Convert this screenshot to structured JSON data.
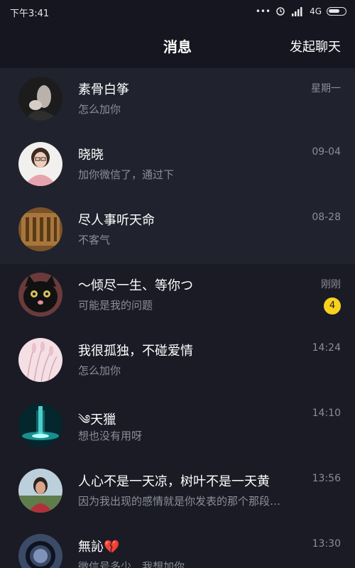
{
  "status_bar": {
    "time": "下午3:41",
    "network": "4G",
    "icons": [
      "more-dots-icon",
      "alarm-icon",
      "hd-signal-icon",
      "battery-icon"
    ]
  },
  "header": {
    "title": "消息",
    "action": "发起聊天"
  },
  "chats": [
    {
      "name": "素骨白筝",
      "preview": "怎么加你",
      "time": "星期一",
      "pinned": true,
      "avatar": "photo-dark-hand"
    },
    {
      "name": "晓晓",
      "preview": "加你微信了，通过下",
      "time": "09-04",
      "pinned": true,
      "avatar": "photo-woman-glasses"
    },
    {
      "name": "尽人事听天命",
      "preview": "不客气",
      "time": "08-28",
      "pinned": true,
      "avatar": "photo-calligraphy"
    },
    {
      "name": "～倾尽一生、等你つ",
      "preview": "可能是我的问题",
      "time": "刚刚",
      "unread": "4",
      "pinned": false,
      "avatar": "photo-black-cat"
    },
    {
      "name": "我很孤独，不碰爱情",
      "preview": "怎么加你",
      "time": "14:24",
      "pinned": false,
      "avatar": "photo-pink-grass"
    },
    {
      "name": "༄天獵",
      "preview": "想也没有用呀",
      "time": "14:10",
      "pinned": false,
      "avatar": "photo-teal-light"
    },
    {
      "name": "人心不是一天凉，树叶不是一天黄",
      "preview": "因为我出现的感情就是你发表的那个那段…",
      "time": "13:56",
      "pinned": false,
      "avatar": "photo-person-outdoor"
    },
    {
      "name": "無訫💔",
      "preview": "微信号多少，我想加你",
      "time": "13:30",
      "pinned": false,
      "avatar": "photo-dark-circle"
    }
  ],
  "colors": {
    "background": "#1a1b25",
    "pinned_background": "#20222d",
    "header_background": "#151620",
    "secondary_text": "#8b8d99",
    "badge": "#f8d11f"
  }
}
